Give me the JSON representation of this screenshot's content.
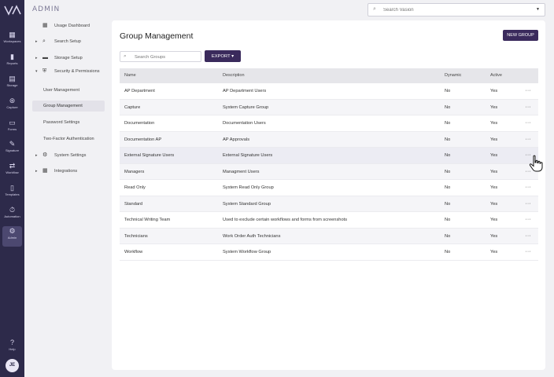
{
  "rail": {
    "items": [
      {
        "icon": "▦",
        "label": "Workspaces"
      },
      {
        "icon": "▮",
        "label": "Reports"
      },
      {
        "icon": "▤",
        "label": "Storage"
      },
      {
        "icon": "⊛",
        "label": "Capture"
      },
      {
        "icon": "▭",
        "label": "Forms"
      },
      {
        "icon": "✎",
        "label": "Signature"
      },
      {
        "icon": "⇄",
        "label": "Workflow"
      },
      {
        "icon": "▯",
        "label": "Templates"
      },
      {
        "icon": "⏱",
        "label": "Automation"
      },
      {
        "icon": "⚙",
        "label": "Admin"
      }
    ],
    "help_label": "Help",
    "avatar_initials": "JE"
  },
  "nav": {
    "title": "ADMIN",
    "items": [
      {
        "label": "Usage Dashboard"
      },
      {
        "label": "Search Setup"
      },
      {
        "label": "Storage Setup"
      },
      {
        "label": "Security & Permissions"
      },
      {
        "label": "System Settings"
      },
      {
        "label": "Integrations"
      }
    ],
    "security_sub": [
      {
        "label": "User Management"
      },
      {
        "label": "Group Management"
      },
      {
        "label": "Password Settings"
      },
      {
        "label": "Two-Factor Authentication"
      }
    ]
  },
  "top_search": {
    "placeholder": "Search Vasion"
  },
  "page": {
    "title": "Group Management",
    "new_group_label": "NEW GROUP",
    "search_placeholder": "Search Groups",
    "export_label": "EXPORT ▾"
  },
  "table": {
    "headers": {
      "name": "Name",
      "description": "Description",
      "dynamic": "Dynamic",
      "active": "Active"
    },
    "rows": [
      {
        "name": "AP Department",
        "description": "AP Department Users",
        "dynamic": "No",
        "active": "Yes"
      },
      {
        "name": "Capture",
        "description": "System Capture Group",
        "dynamic": "No",
        "active": "Yes"
      },
      {
        "name": "Documentation",
        "description": "Documentation Users",
        "dynamic": "No",
        "active": "Yes"
      },
      {
        "name": "Documentation AP",
        "description": "AP Approvals",
        "dynamic": "No",
        "active": "Yes"
      },
      {
        "name": "External Signature Users",
        "description": "External Signature Users",
        "dynamic": "No",
        "active": "Yes"
      },
      {
        "name": "Managers",
        "description": "Managment Users",
        "dynamic": "No",
        "active": "Yes"
      },
      {
        "name": "Read Only",
        "description": "System Read Only Group",
        "dynamic": "No",
        "active": "Yes"
      },
      {
        "name": "Standard",
        "description": "System Standard Group",
        "dynamic": "No",
        "active": "Yes"
      },
      {
        "name": "Technical Writing Team",
        "description": "Used to exclude certain workflows and forms from screenshots",
        "dynamic": "No",
        "active": "Yes"
      },
      {
        "name": "Technicians",
        "description": "Work Order Auth Technicians",
        "dynamic": "No",
        "active": "Yes"
      },
      {
        "name": "Workflow",
        "description": "System Workflow Group",
        "dynamic": "No",
        "active": "Yes"
      }
    ],
    "more_glyph": "···"
  },
  "colors": {
    "accent": "#3a2a5c",
    "rail": "#2d2a4a"
  }
}
